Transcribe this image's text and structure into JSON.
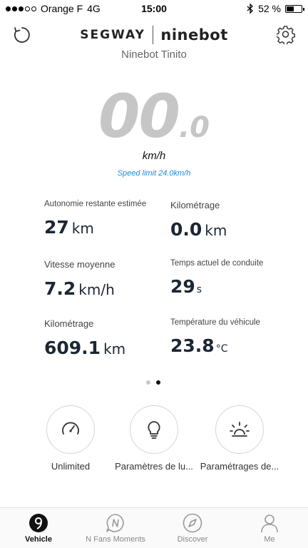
{
  "status_bar": {
    "carrier": "Orange F",
    "network": "4G",
    "time": "15:00",
    "battery_text": "52 %",
    "battery_level": 0.52
  },
  "header": {
    "brand_left": "SEGWAY",
    "brand_right": "ninebot",
    "device_name": "Ninebot Tinito"
  },
  "speed": {
    "main": "00",
    "decimal": ".0",
    "unit": "km/h",
    "limit": "Speed limit 24.0km/h"
  },
  "stats": [
    {
      "label": "Autonomie restante estimée",
      "value": "27",
      "unit": "km"
    },
    {
      "label": "Kilométrage",
      "value": "0.0",
      "unit": "km"
    },
    {
      "label": "Vitesse moyenne",
      "value": "7.2",
      "unit": "km/h"
    },
    {
      "label": "Temps actuel de conduite",
      "value": "29",
      "unit": "s"
    },
    {
      "label": "Kilométrage",
      "value": "609.1",
      "unit": "km"
    },
    {
      "label": "Température du véhicule",
      "value": "23.8",
      "unit": "°C"
    }
  ],
  "pager": {
    "count": 2,
    "active": 2
  },
  "actions": [
    {
      "label": "Unlimited",
      "icon": "speedometer-icon"
    },
    {
      "label": "Paramètres de lu...",
      "icon": "light-bulb-icon"
    },
    {
      "label": "Paramétrages de...",
      "icon": "alarm-light-icon"
    }
  ],
  "tabs": [
    {
      "label": "Vehicle",
      "icon": "vehicle-icon",
      "active": true
    },
    {
      "label": "N Fans Moments",
      "icon": "n-fans-icon",
      "active": false
    },
    {
      "label": "Discover",
      "icon": "compass-icon",
      "active": false
    },
    {
      "label": "Me",
      "icon": "person-icon",
      "active": false
    }
  ],
  "colors": {
    "accent": "#1a8fd8",
    "speed_digits": "#c6c6c6",
    "value_text": "#1c2733"
  }
}
